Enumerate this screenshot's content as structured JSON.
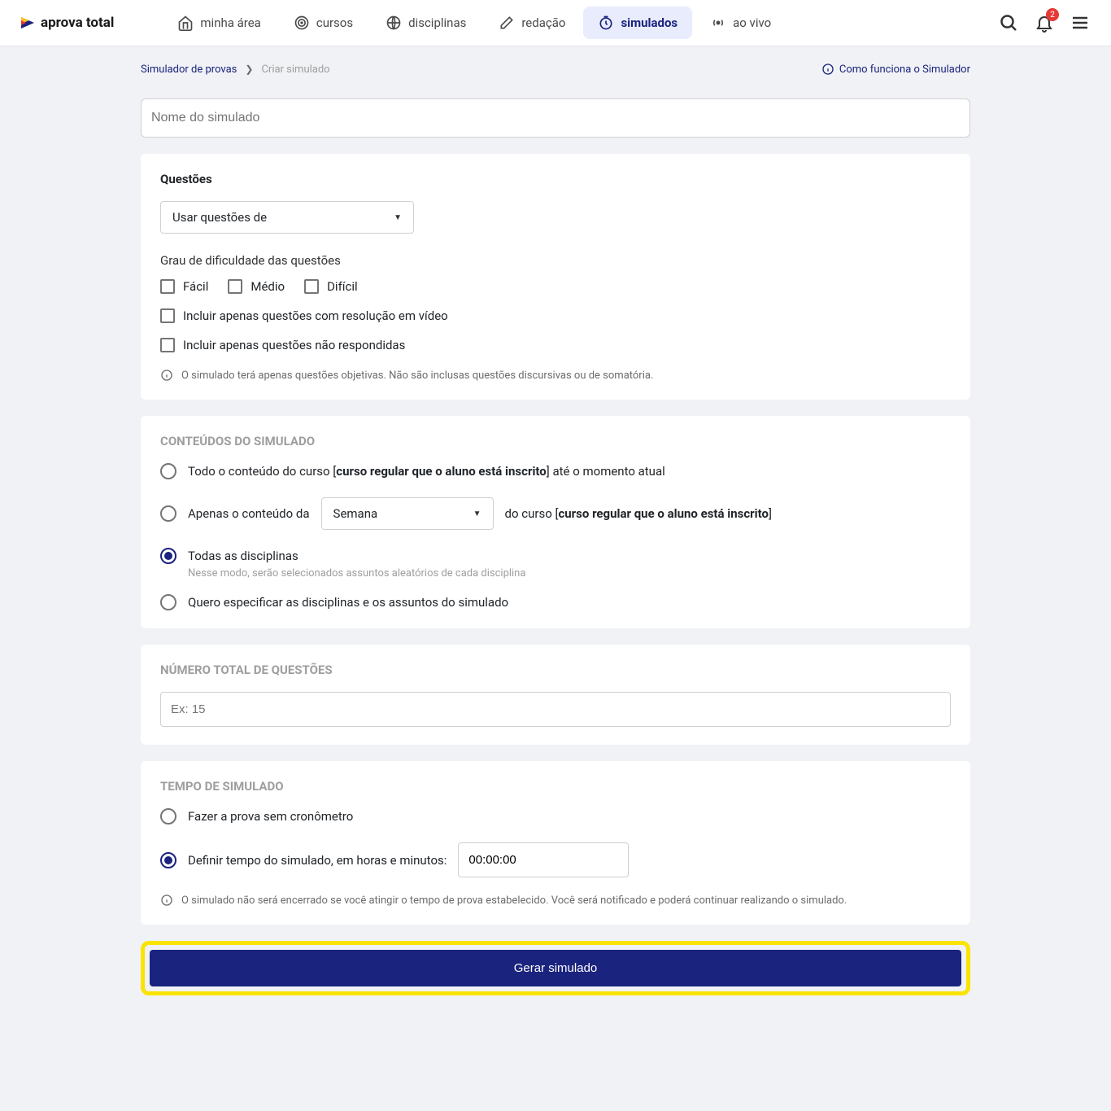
{
  "header": {
    "logo_text": "aprova total",
    "nav": [
      {
        "label": "minha área",
        "icon": "home-icon"
      },
      {
        "label": "cursos",
        "icon": "target-icon"
      },
      {
        "label": "disciplinas",
        "icon": "globe-icon"
      },
      {
        "label": "redação",
        "icon": "pen-icon"
      },
      {
        "label": "simulados",
        "icon": "timer-icon",
        "active": true
      },
      {
        "label": "ao vivo",
        "icon": "broadcast-icon"
      }
    ],
    "badge_count": "2"
  },
  "breadcrumb": {
    "parent": "Simulador de provas",
    "current": "Criar simulado"
  },
  "help_link": "Como funciona o Simulador",
  "name_input_placeholder": "Nome do simulado",
  "questions_section": {
    "title": "Questões",
    "source_select_label": "Usar questões de",
    "difficulty_label": "Grau de dificuldade das questões",
    "difficulty_options": [
      "Fácil",
      "Médio",
      "Difícil"
    ],
    "include_video": "Incluir apenas questões com resolução em vídeo",
    "include_unanswered": "Incluir apenas questões não respondidas",
    "note": "O simulado terá apenas questões objetivas. Não são inclusas questões discursivas ou de somatória."
  },
  "content_section": {
    "title": "CONTEÚDOS DO SIMULADO",
    "opt_all_pre": "Todo o conteúdo do curso [",
    "opt_all_bold": "curso regular que o aluno está inscrito",
    "opt_all_post": "] até o momento atual",
    "opt_week_pre": "Apenas o conteúdo da",
    "week_select_label": "Semana",
    "opt_week_mid": "do curso [",
    "opt_week_bold": "curso regular que o aluno está inscrito",
    "opt_week_post": "]",
    "opt_all_disc": "Todas as disciplinas",
    "opt_all_disc_helper": "Nesse modo, serão selecionados assuntos aleatórios de cada disciplina",
    "opt_specify": "Quero especificar as disciplinas e os assuntos do simulado"
  },
  "num_section": {
    "title": "NÚMERO TOTAL DE QUESTÕES",
    "placeholder": "Ex: 15"
  },
  "time_section": {
    "title": "TEMPO DE SIMULADO",
    "opt_no_timer": "Fazer a prova sem cronômetro",
    "opt_timer": "Definir tempo do simulado, em horas e minutos:",
    "time_value": "00:00:00",
    "note": "O simulado não será encerrado se você atingir o tempo de prova estabelecido. Você será notificado e poderá continuar realizando o simulado."
  },
  "generate_button": "Gerar simulado"
}
